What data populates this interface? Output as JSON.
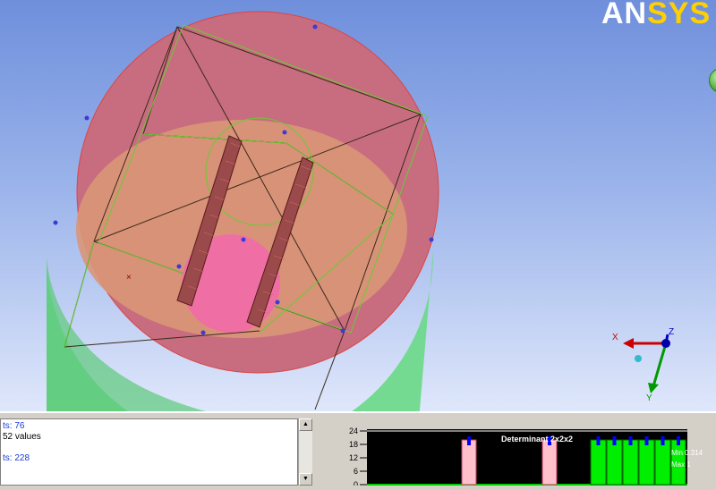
{
  "branding": {
    "logo_main": "AN",
    "logo_accent": "SYS"
  },
  "triad": {
    "x_label": "X",
    "y_label": "Y",
    "z_label": "Z"
  },
  "messages": {
    "lines": [
      {
        "text": "ts: 76",
        "color": "blue"
      },
      {
        "text": "52 values",
        "color": "black"
      },
      {
        "text": "ts: 228",
        "color": "blue"
      }
    ]
  },
  "scrollbar": {
    "up_arrow": "▲",
    "down_arrow": "▼"
  },
  "histogram": {
    "title": "Determinant 2x2x2",
    "min_label": "Min 0.314",
    "max_label": "Max 1",
    "y_ticks": [
      "24",
      "18",
      "12",
      "6",
      "0"
    ]
  },
  "colors": {
    "cylinder_side": "#6fd98c",
    "top_face": "#c86d7f",
    "inner_disk": "#d99678",
    "hole": "#ef6fa5",
    "histo_bg": "#000000",
    "histo_pink": "#ffc0cb",
    "histo_green": "#00ee00",
    "histo_marker": "#0000ff"
  },
  "chart_data": {
    "type": "bar",
    "title": "Determinant 2x2x2",
    "ylim": [
      0,
      24
    ],
    "y_ticks": [
      0,
      6,
      12,
      18,
      24
    ],
    "bars": [
      {
        "color": "pink",
        "value": 20
      },
      {
        "color": "pink",
        "value": 20
      },
      {
        "color": "green",
        "value": 20
      },
      {
        "color": "green",
        "value": 20
      },
      {
        "color": "green",
        "value": 20
      },
      {
        "color": "green",
        "value": 20
      },
      {
        "color": "green",
        "value": 20
      },
      {
        "color": "green",
        "value": 20
      }
    ],
    "annotations": [
      "Min 0.314",
      "Max 1"
    ]
  }
}
